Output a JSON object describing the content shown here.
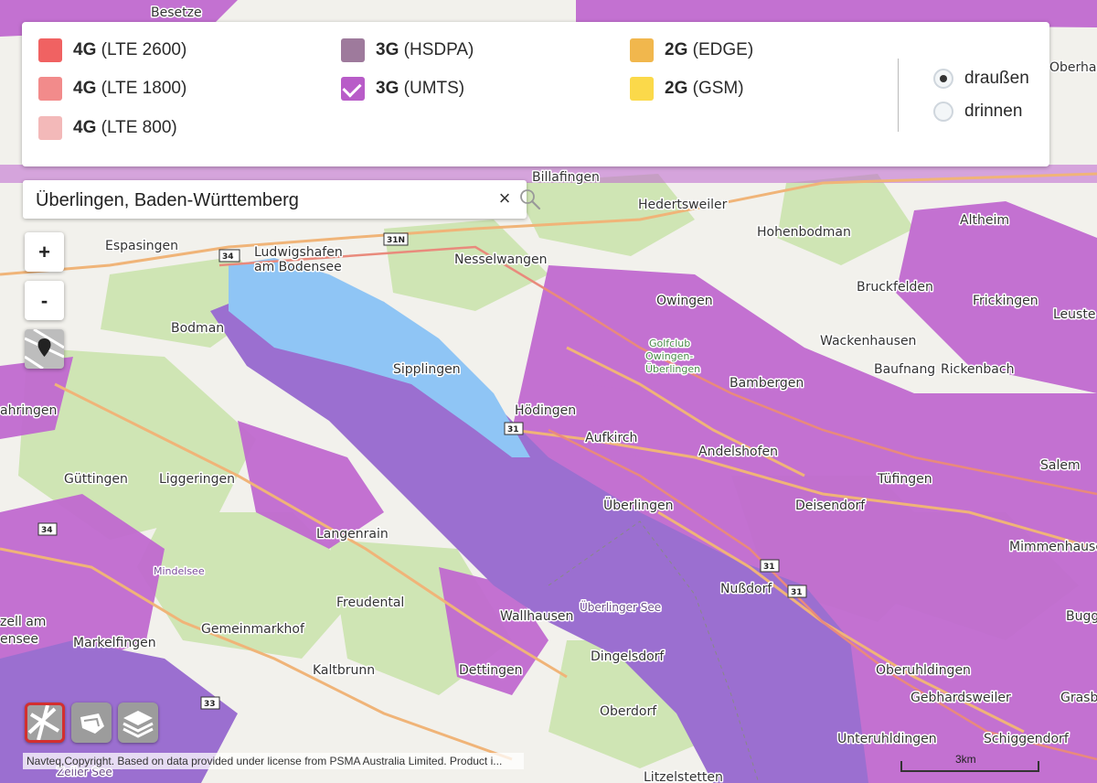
{
  "legend": {
    "items": [
      {
        "gen": "4G",
        "band": "(LTE 2600)",
        "color": "#f06262",
        "checked": false
      },
      {
        "gen": "4G",
        "band": "(LTE 1800)",
        "color": "#f28b8b",
        "checked": false
      },
      {
        "gen": "4G",
        "band": "(LTE 800)",
        "color": "#f3b9b9",
        "checked": false
      },
      {
        "gen": "3G",
        "band": "(HSDPA)",
        "color": "#9e7a9c",
        "checked": false
      },
      {
        "gen": "3G",
        "band": "(UMTS)",
        "color": "#b85cc8",
        "checked": true
      },
      {
        "gen": "2G",
        "band": "(EDGE)",
        "color": "#f1b74d",
        "checked": false
      },
      {
        "gen": "2G",
        "band": "(GSM)",
        "color": "#fbd94a",
        "checked": false
      }
    ],
    "radios": [
      {
        "label": "draußen",
        "selected": true
      },
      {
        "label": "drinnen",
        "selected": false
      }
    ]
  },
  "search": {
    "value": "Überlingen, Baden-Württemberg",
    "clear_icon": "×"
  },
  "zoom": {
    "in_label": "+",
    "out_label": "-"
  },
  "map": {
    "labels": [
      {
        "text": "Besetze"
      },
      {
        "text": "Billafingen"
      },
      {
        "text": "Hedertsweiler"
      },
      {
        "text": "Altheim"
      },
      {
        "text": "Hohenbodman"
      },
      {
        "text": "Espasingen"
      },
      {
        "text": "Ludwigshafen"
      },
      {
        "text": "am Bodensee"
      },
      {
        "text": "Nesselwangen"
      },
      {
        "text": "Owingen"
      },
      {
        "text": "Bruckfelden"
      },
      {
        "text": "Frickingen"
      },
      {
        "text": "Bodman"
      },
      {
        "text": "Wackenhausen"
      },
      {
        "text": "Sipplingen"
      },
      {
        "text": "Bambergen"
      },
      {
        "text": "Baufnang"
      },
      {
        "text": "Rickenbach"
      },
      {
        "text": "ahringen"
      },
      {
        "text": "Hödingen"
      },
      {
        "text": "Aufkirch"
      },
      {
        "text": "Andelshofen"
      },
      {
        "text": "Güttingen"
      },
      {
        "text": "Liggeringen"
      },
      {
        "text": "Tüfingen"
      },
      {
        "text": "Salem"
      },
      {
        "text": "Überlingen"
      },
      {
        "text": "Deisendorf"
      },
      {
        "text": "Langenrain"
      },
      {
        "text": "Mimmenhause"
      },
      {
        "text": "Nußdorf"
      },
      {
        "text": "Freudental"
      },
      {
        "text": "Überlinger See"
      },
      {
        "text": "Gemeinmarkhof"
      },
      {
        "text": "Wallhausen"
      },
      {
        "text": "zell am"
      },
      {
        "text": "ensee"
      },
      {
        "text": "Markelfingen"
      },
      {
        "text": "Dingelsdorf"
      },
      {
        "text": "Kaltbrunn"
      },
      {
        "text": "Dettingen"
      },
      {
        "text": "Oberuhldingen"
      },
      {
        "text": "Gebhardsweiler"
      },
      {
        "text": "Oberdorf"
      },
      {
        "text": "Unteruhldingen"
      },
      {
        "text": "Schiggendorf"
      },
      {
        "text": "Leuste"
      },
      {
        "text": "Oberha"
      },
      {
        "text": "Bugg"
      },
      {
        "text": "Grasbe"
      },
      {
        "text": "Mindelsee"
      },
      {
        "text": "Golfclub"
      },
      {
        "text": "Owingen-"
      },
      {
        "text": "Überlingen"
      },
      {
        "text": "Litzelstetten"
      },
      {
        "text": "Zeller See"
      }
    ],
    "road_numbers": [
      "34",
      "31N",
      "31",
      "34",
      "31",
      "31",
      "33"
    ],
    "coverage_color": "#c06ad0",
    "lake_color": "#9b6fd0",
    "water_color": "#8fc5f5"
  },
  "attribution": "Navteq,Copyright. Based on data provided under license from PSMA Australia Limited. Product i...",
  "scale": {
    "label": "3km"
  }
}
